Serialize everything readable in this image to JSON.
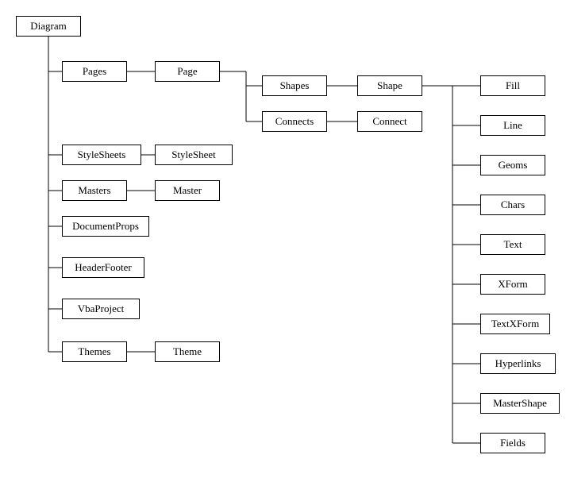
{
  "root": "Diagram",
  "level1": {
    "pages": "Pages",
    "stylesheets": "StyleSheets",
    "masters": "Masters",
    "documentprops": "DocumentProps",
    "headerfooter": "HeaderFooter",
    "vbaproject": "VbaProject",
    "themes": "Themes"
  },
  "level2": {
    "page": "Page",
    "stylesheet": "StyleSheet",
    "master": "Master",
    "theme": "Theme"
  },
  "page_children": {
    "shapes": "Shapes",
    "connects": "Connects"
  },
  "shapes_child": "Shape",
  "connects_child": "Connect",
  "shape_children": {
    "fill": "Fill",
    "line": "Line",
    "geoms": "Geoms",
    "chars": "Chars",
    "text": "Text",
    "xform": "XForm",
    "textxform": "TextXForm",
    "hyperlinks": "Hyperlinks",
    "mastershape": "MasterShape",
    "fields": "Fields"
  }
}
